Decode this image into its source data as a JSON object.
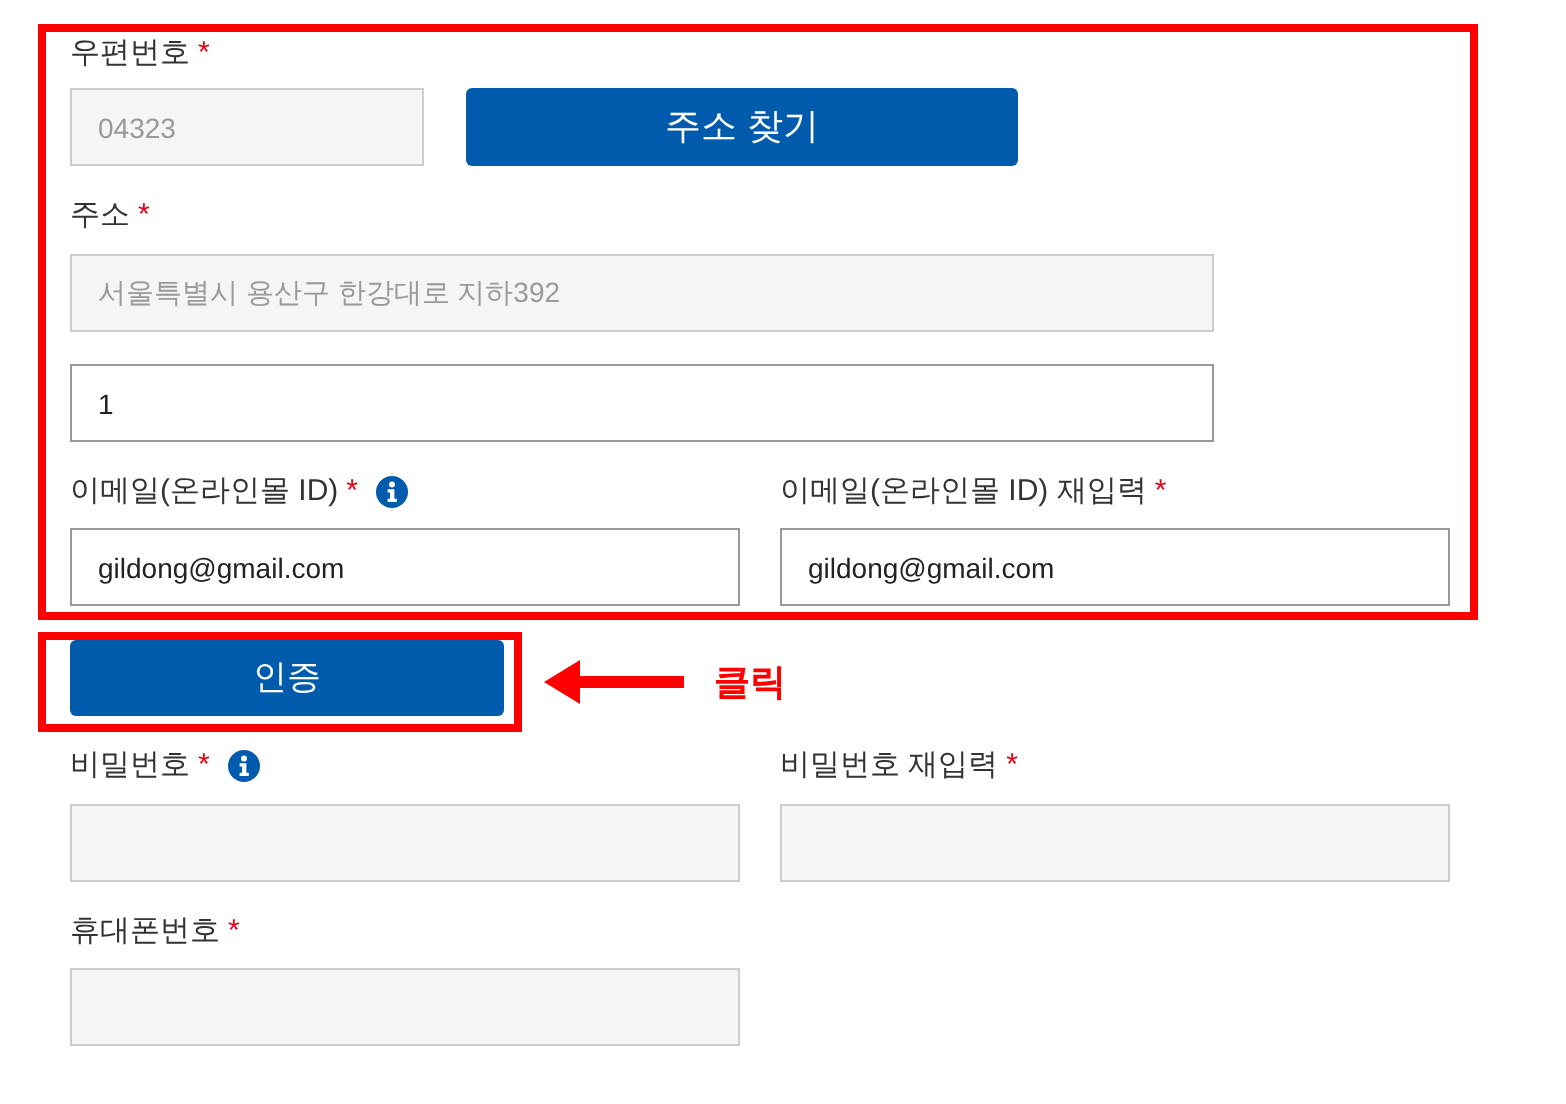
{
  "postcode": {
    "label": "우편번호",
    "required_mark": "*",
    "value": "04323",
    "disabled": true
  },
  "find_address_button": "주소 찾기",
  "address": {
    "label": "주소",
    "required_mark": "*",
    "value": "서울특별시 용산구 한강대로 지하392",
    "disabled": true
  },
  "address_detail": {
    "value": "1",
    "disabled": false
  },
  "email": {
    "label": "이메일(온라인몰 ID)",
    "required_mark": "*",
    "info": true,
    "value": "gildong@gmail.com",
    "disabled": false
  },
  "email_confirm": {
    "label": "이메일(온라인몰 ID) 재입력",
    "required_mark": "*",
    "value": "gildong@gmail.com",
    "disabled": false
  },
  "verify_button": "인증",
  "annotation": "클릭",
  "password": {
    "label": "비밀번호",
    "required_mark": "*",
    "info": true,
    "disabled": true
  },
  "password_confirm": {
    "label": "비밀번호 재입력",
    "required_mark": "*",
    "disabled": true
  },
  "phone": {
    "label": "휴대폰번호",
    "required_mark": "*",
    "disabled": true
  }
}
